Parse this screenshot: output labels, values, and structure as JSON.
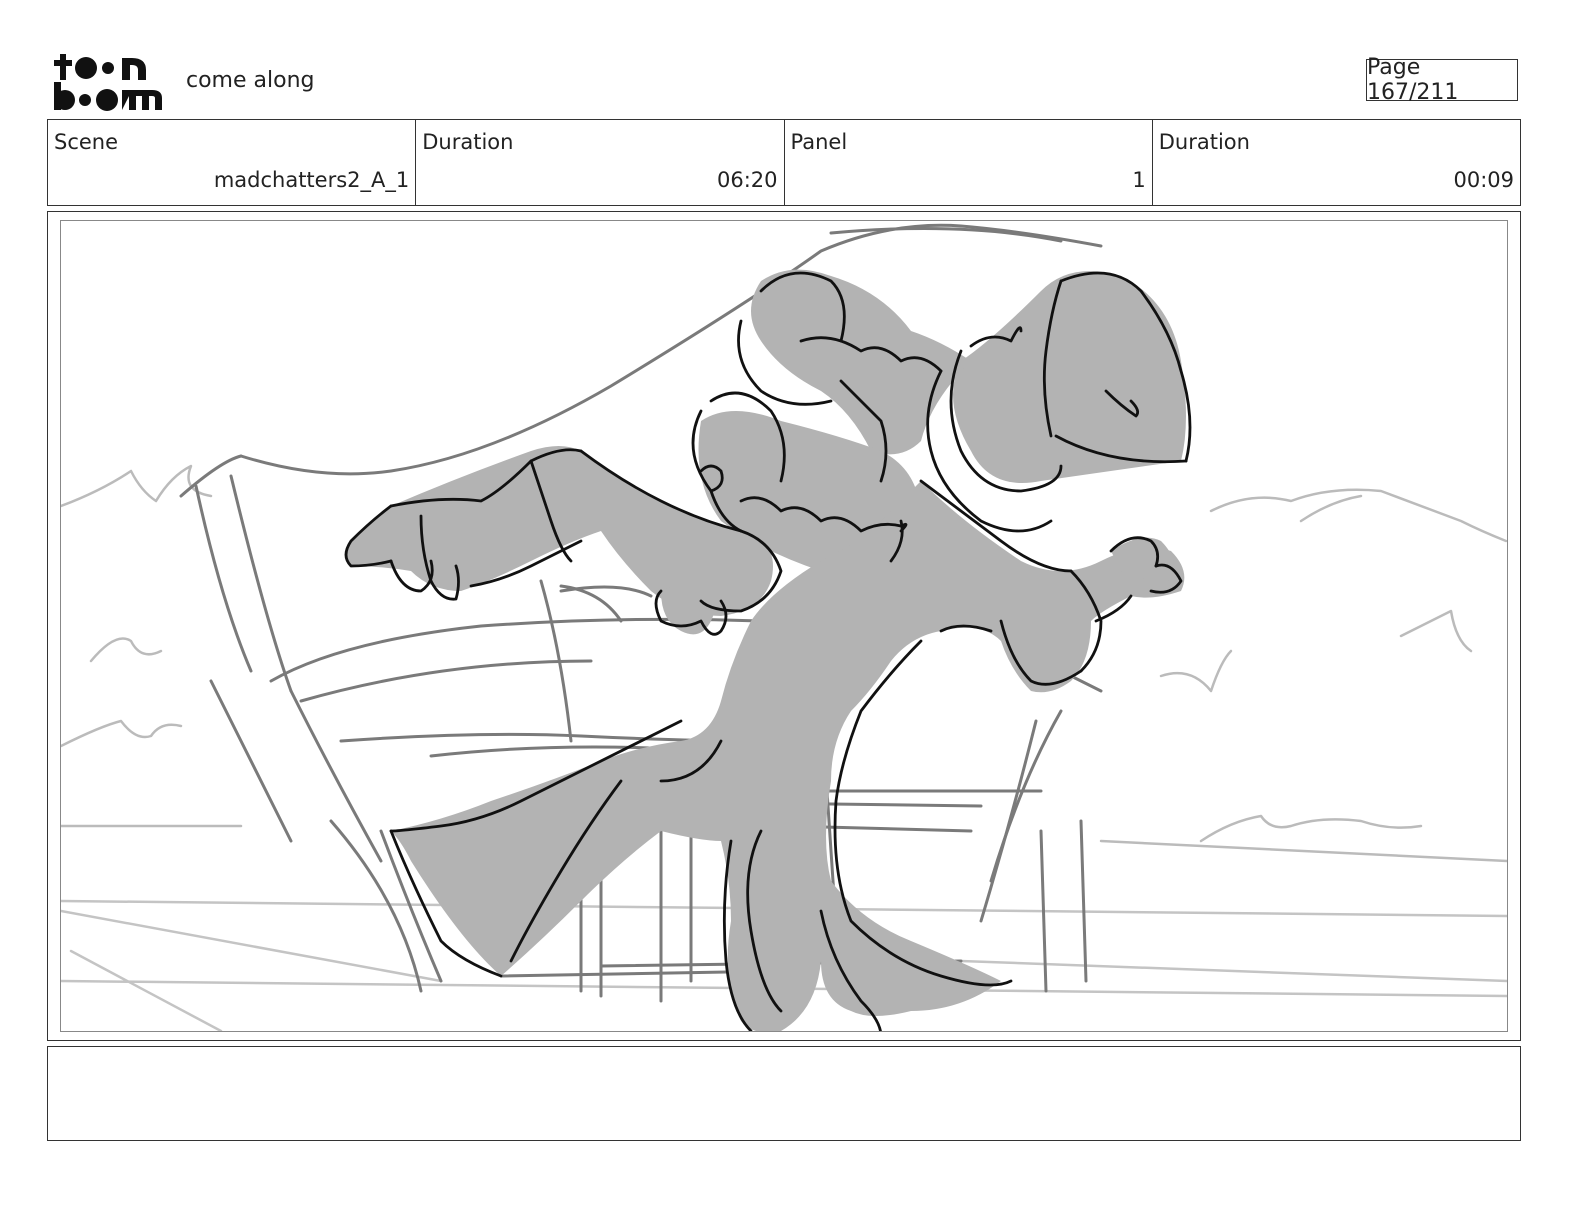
{
  "header": {
    "logo_text": "toon boom",
    "project_title": "come along",
    "page_label": "Page 167/211"
  },
  "info": {
    "scene_label": "Scene",
    "scene_value": "madchatters2_A_1",
    "scene_duration_label": "Duration",
    "scene_duration_value": "06:20",
    "panel_label": "Panel",
    "panel_value": "1",
    "panel_duration_label": "Duration",
    "panel_duration_value": "00:09"
  },
  "notes": {
    "text": ""
  },
  "colors": {
    "fill_gray": "#b3b3b3",
    "ink": "#111111",
    "bg_line": "#888888"
  }
}
